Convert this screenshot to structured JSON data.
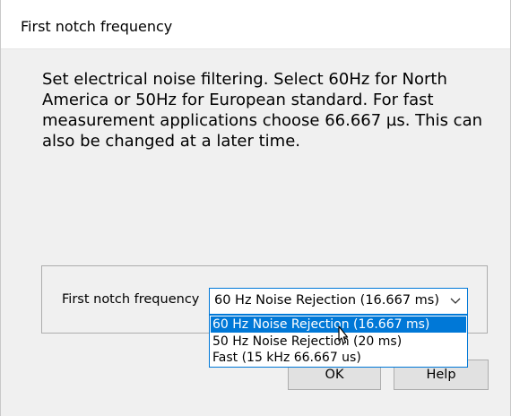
{
  "window": {
    "title": "First notch frequency"
  },
  "description": "Set electrical noise filtering. Select 60Hz for North America or 50Hz for European standard. For fast measurement applications choose 66.667 µs. This can also be changed at a later time.",
  "field": {
    "label": "First notch frequency",
    "selected_value": "60 Hz Noise Rejection (16.667 ms)",
    "options": [
      "60 Hz Noise Rejection (16.667 ms)",
      "50 Hz Noise Rejection (20 ms)",
      "Fast (15 kHz 66.667 us)"
    ],
    "highlighted_option_index": 0
  },
  "buttons": {
    "ok_label": "OK",
    "help_label": "Help"
  },
  "colors": {
    "accent": "#0078d7",
    "dialog_background": "#f0f0f0",
    "button_background": "#e1e1e1"
  },
  "icons": {
    "combo_arrow": "chevron-down-icon",
    "cursor": "mouse-pointer-icon"
  }
}
